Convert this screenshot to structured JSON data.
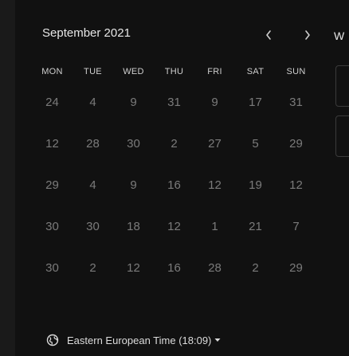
{
  "calendar": {
    "month_label": "September 2021",
    "weekdays": [
      "MON",
      "TUE",
      "WED",
      "THU",
      "FRI",
      "SAT",
      "SUN"
    ],
    "weeks": [
      [
        "24",
        "4",
        "9",
        "31",
        "9",
        "17",
        "31"
      ],
      [
        "12",
        "28",
        "30",
        "2",
        "27",
        "5",
        "29"
      ],
      [
        "29",
        "4",
        "9",
        "16",
        "12",
        "19",
        "12"
      ],
      [
        "30",
        "30",
        "18",
        "12",
        "1",
        "21",
        "7"
      ],
      [
        "30",
        "2",
        "12",
        "16",
        "28",
        "2",
        "29"
      ]
    ],
    "prev_icon": "chevron-left-icon",
    "next_icon": "chevron-right-icon"
  },
  "timezone": {
    "label": "Eastern European Time (18:09)",
    "icon": "globe-icon",
    "dropdown_icon": "caret-down-icon"
  },
  "side_panel": {
    "title": "W"
  },
  "colors": {
    "background": "#0b0b0b",
    "panel": "#111111",
    "text_primary": "#e6e6e6",
    "text_muted": "#7b7b7b"
  }
}
